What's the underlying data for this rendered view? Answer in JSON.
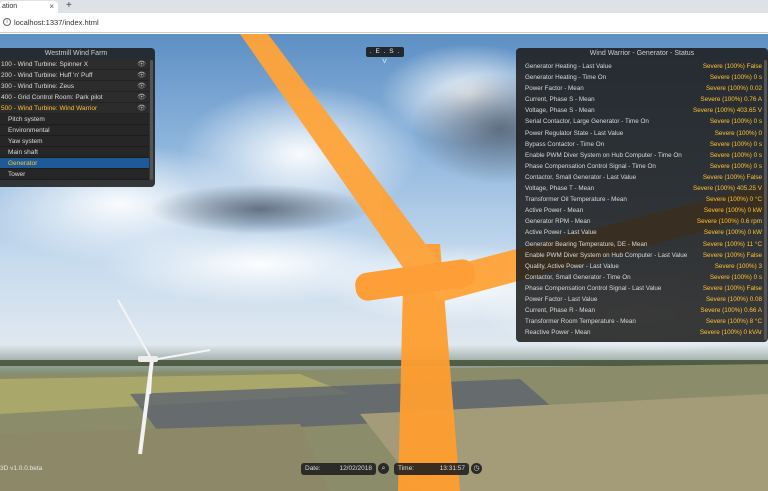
{
  "browser": {
    "tab_title": "ation",
    "tab_close": "×",
    "new_tab": "+",
    "url": "localhost:1337/index.html"
  },
  "nav": {
    "label": ". E . S . V"
  },
  "farm_panel": {
    "title": "Westmill Wind Farm",
    "turbines": [
      {
        "label": "100 - Wind Turbine: Spinner X"
      },
      {
        "label": "200 - Wind Turbine: Huff 'n' Puff"
      },
      {
        "label": "300 - Wind Turbine: Zeus"
      },
      {
        "label": "400 - Grid Control Room: Park pilot"
      },
      {
        "label": "500 - Wind Turbine: Wind Warrior"
      }
    ],
    "eye_icon": "👁",
    "systems": [
      {
        "label": "Pitch system"
      },
      {
        "label": "Environmental"
      },
      {
        "label": "Yaw system"
      },
      {
        "label": "Main shaft"
      },
      {
        "label": "Generator"
      },
      {
        "label": "Tower"
      }
    ]
  },
  "status_panel": {
    "title": "Wind Warrior - Generator - Status",
    "rows": [
      {
        "label": "Generator Heating - Last Value",
        "value": "Severe (100%)  False"
      },
      {
        "label": "Generator Heating - Time On",
        "value": "Severe (100%)  0 s"
      },
      {
        "label": "Power Factor - Mean",
        "value": "Severe (100%)  0.02"
      },
      {
        "label": "Current, Phase S - Mean",
        "value": "Severe (100%)  0.76 A"
      },
      {
        "label": "Voltage, Phase S - Mean",
        "value": "Severe (100%)  403.65 V"
      },
      {
        "label": "Serial Contactor, Large Generator - Time On",
        "value": "Severe (100%)  0 s"
      },
      {
        "label": "Power Regulator State - Last Value",
        "value": "Severe (100%)  0"
      },
      {
        "label": "Bypass Contactor - Time On",
        "value": "Severe (100%)  0 s"
      },
      {
        "label": "Enable PWM Diver System on Hub Computer - Time On",
        "value": "Severe (100%)  0 s"
      },
      {
        "label": "Phase Compensation Control Signal - Time On",
        "value": "Severe (100%)  0 s"
      },
      {
        "label": "Contactor, Small Generator - Last Value",
        "value": "Severe (100%)  False"
      },
      {
        "label": "Voltage, Phase T - Mean",
        "value": "Severe (100%)  405.25 V"
      },
      {
        "label": "Transformer Oil Temperature - Mean",
        "value": "Severe (100%)  0 °C"
      },
      {
        "label": "Active Power - Mean",
        "value": "Severe (100%)  0 kW"
      },
      {
        "label": "Generator RPM - Mean",
        "value": "Severe (100%)  0.6 rpm"
      },
      {
        "label": "Active Power - Last Value",
        "value": "Severe (100%)  0 kW"
      },
      {
        "label": "Generator Bearing Temperature, DE - Mean",
        "value": "Severe (100%)  11 °C"
      },
      {
        "label": "Enable PWM Diver System on Hub Computer - Last Value",
        "value": "Severe (100%)  False"
      },
      {
        "label": "Quality, Active Power - Last Value",
        "value": "Severe (100%)  3"
      },
      {
        "label": "Contactor, Small Generator - Time On",
        "value": "Severe (100%)  0 s"
      },
      {
        "label": "Phase Compensation Control Signal - Last Value",
        "value": "Severe (100%)  False"
      },
      {
        "label": "Power Factor - Last Value",
        "value": "Severe (100%)  0.08"
      },
      {
        "label": "Current, Phase R - Mean",
        "value": "Severe (100%)  0.66 A"
      },
      {
        "label": "Transformer Room Temperature - Mean",
        "value": "Severe (100%)  8 °C"
      },
      {
        "label": "Reactive Power - Mean",
        "value": "Severe (100%)  0 kVAr"
      }
    ]
  },
  "footer": {
    "date_label": "Date:",
    "date_value": "12/02/2018",
    "time_label": "Time:",
    "time_value": "13:31:57",
    "version": "3D v1.0.0.beta"
  },
  "colors": {
    "accent": "#ffc233",
    "turbine_highlight": "#ff9e30",
    "selected_row": "#1e5a9a"
  }
}
